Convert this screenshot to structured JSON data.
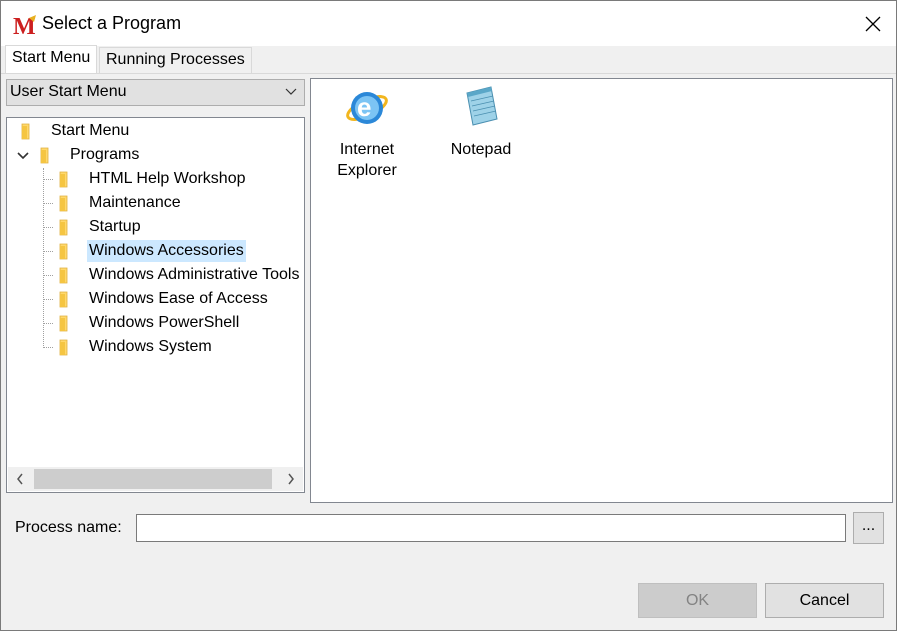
{
  "window": {
    "title": "Select a Program",
    "app_icon": "M-logo-icon",
    "close_icon": "close-icon"
  },
  "tabs": [
    {
      "label": "Start Menu",
      "active": true
    },
    {
      "label": "Running Processes",
      "active": false
    }
  ],
  "source_select": {
    "value": "User Start Menu",
    "icon": "chevron-down-icon"
  },
  "tree": {
    "root": "Start Menu",
    "programs": "Programs",
    "children": [
      "HTML Help Workshop",
      "Maintenance",
      "Startup",
      "Windows Accessories",
      "Windows Administrative Tools",
      "Windows Ease of Access",
      "Windows PowerShell",
      "Windows System"
    ],
    "selected": "Windows Accessories"
  },
  "programs": [
    {
      "name": "Internet Explorer",
      "line1": "Internet",
      "line2": "Explorer",
      "icon": "internet-explorer-icon"
    },
    {
      "name": "Notepad",
      "line1": "Notepad",
      "line2": "",
      "icon": "notepad-icon"
    }
  ],
  "process": {
    "label": "Process name:",
    "value": "",
    "browse_label": "..."
  },
  "buttons": {
    "ok": "OK",
    "cancel": "Cancel"
  },
  "colors": {
    "selection": "#cce8ff",
    "folder": "#ffd86b",
    "app_icon_red": "#cc1f1f"
  }
}
